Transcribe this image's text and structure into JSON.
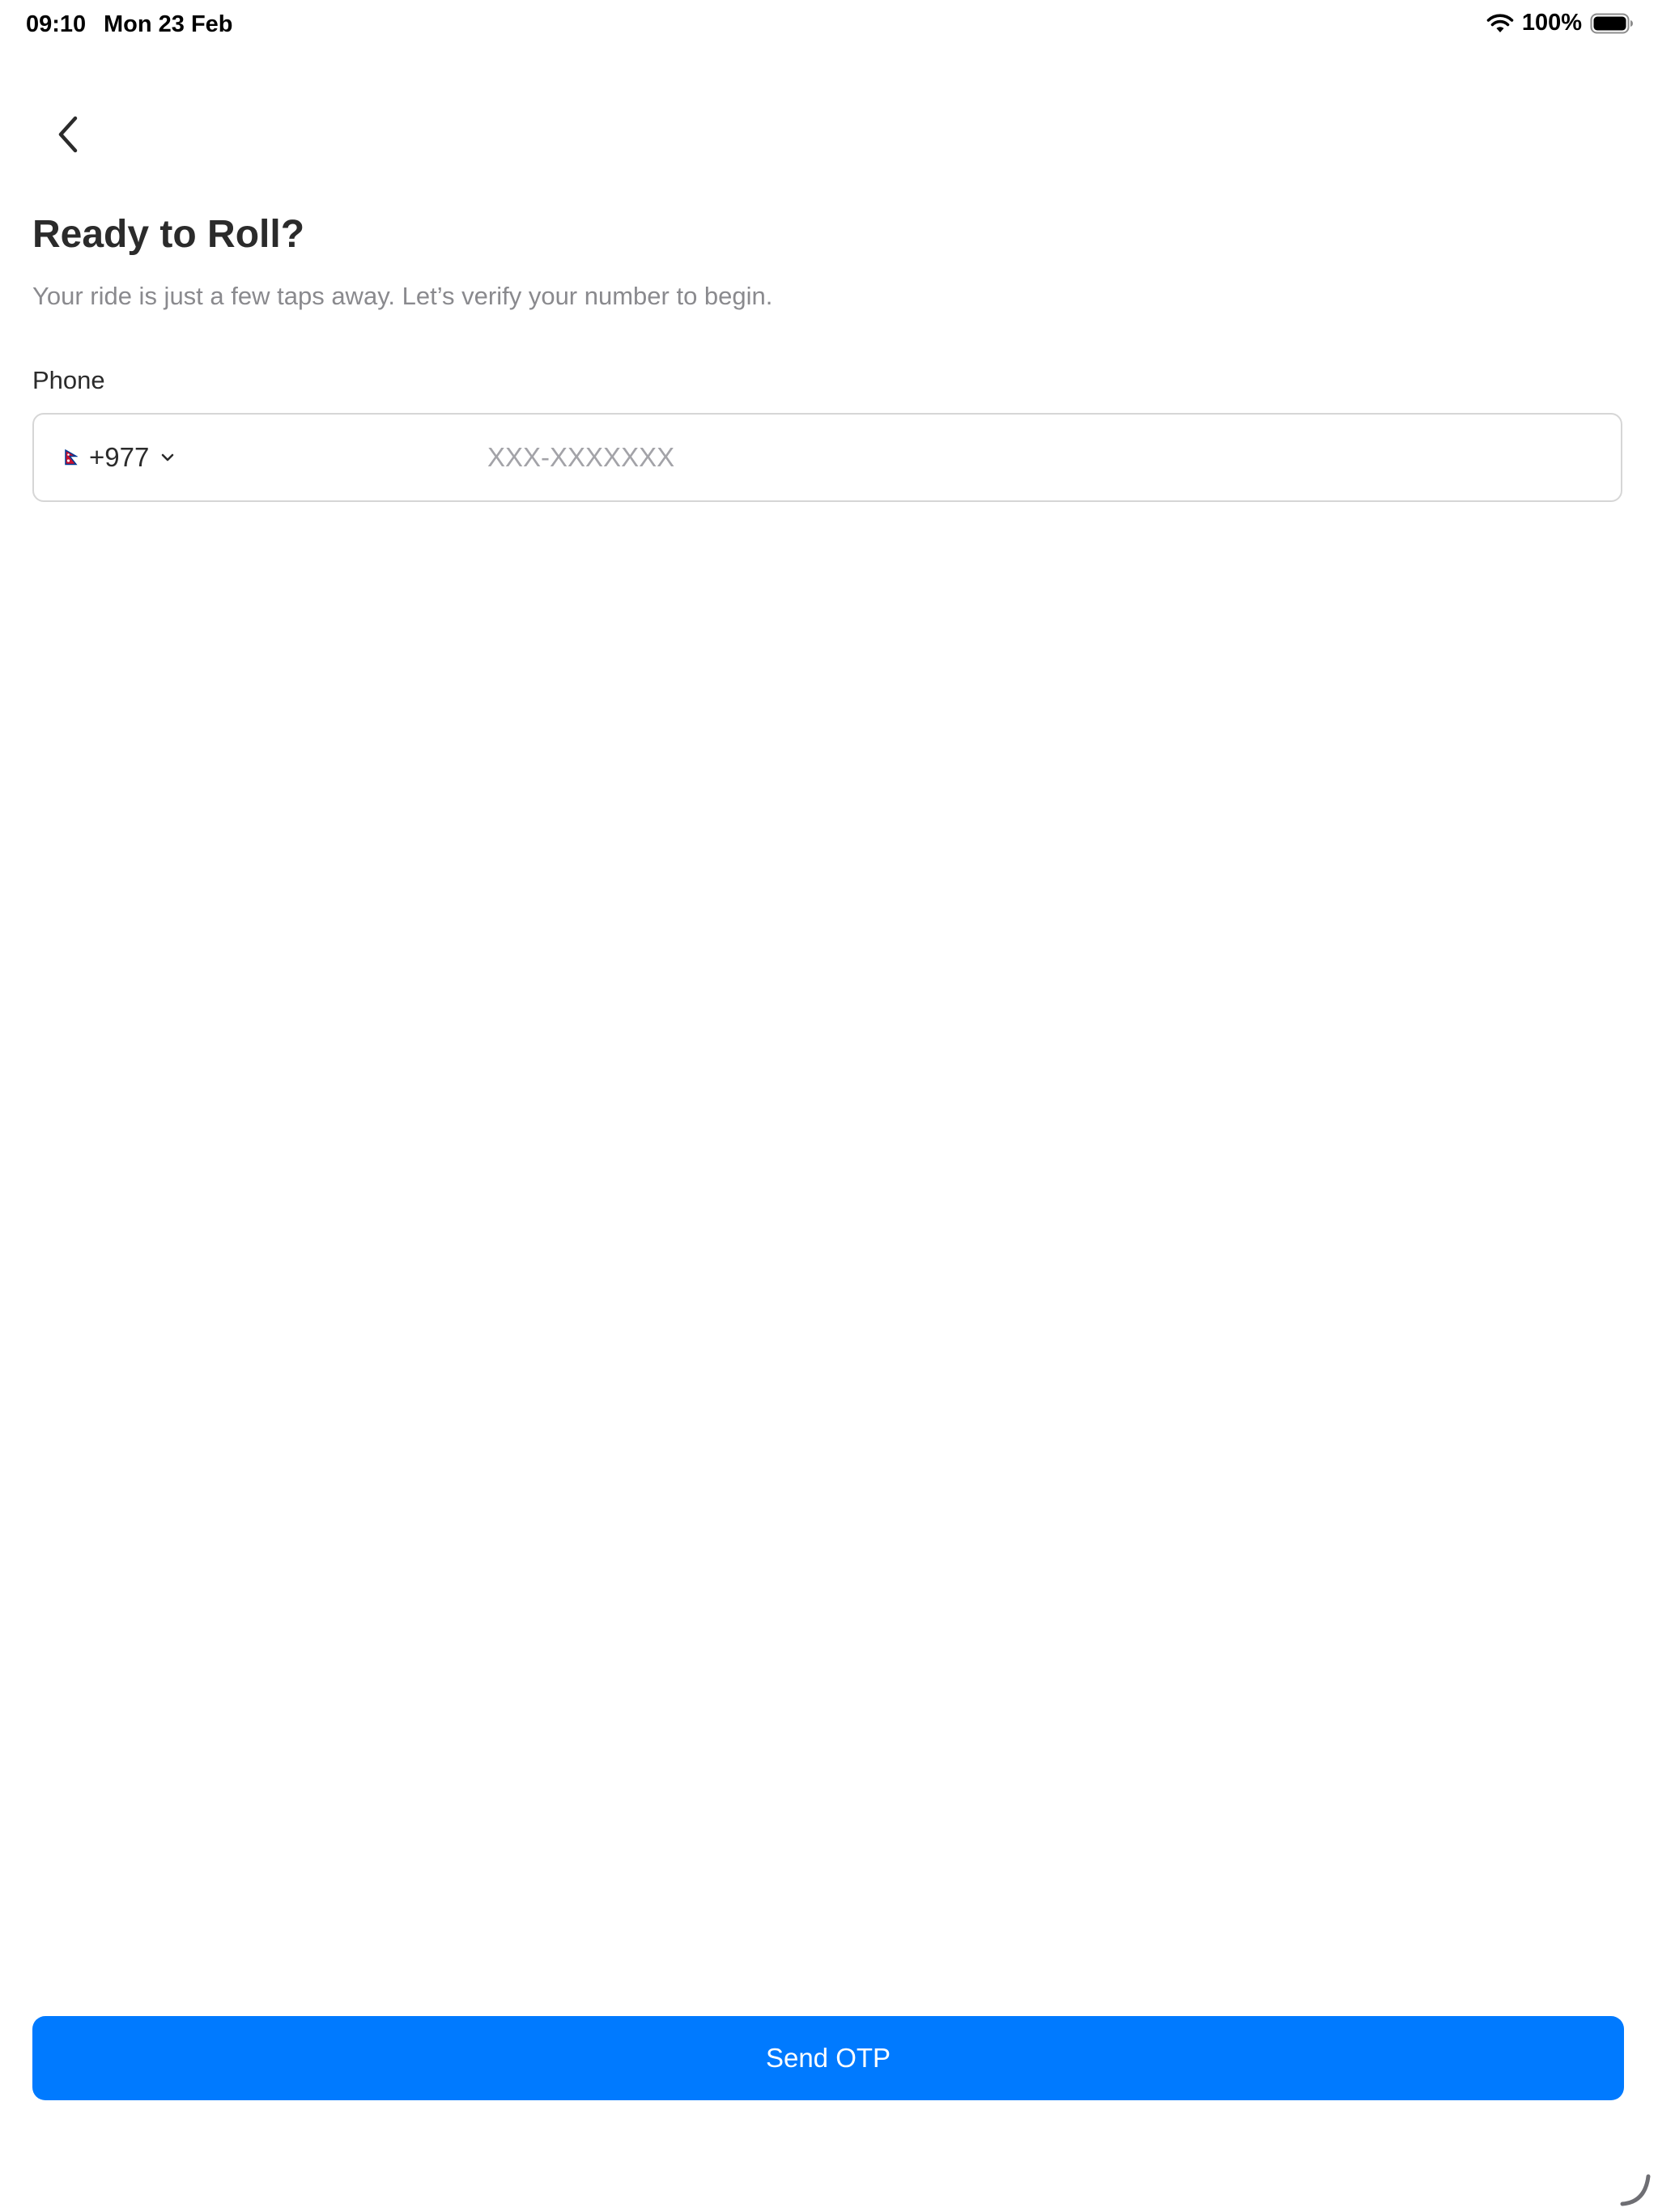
{
  "status_bar": {
    "time": "09:10",
    "date": "Mon 23 Feb",
    "battery_percent": "100%",
    "wifi_icon": "wifi-icon",
    "battery_icon": "battery-full-icon"
  },
  "nav": {
    "back_icon": "chevron-left-icon"
  },
  "header": {
    "title": "Ready to Roll?",
    "subtitle": "Your ride is just a few taps away. Let’s verify your number to begin."
  },
  "phone": {
    "label": "Phone",
    "country_flag_icon": "nepal-flag-icon",
    "country_code": "+977",
    "dropdown_icon": "chevron-down-icon",
    "placeholder": "XXX-XXXXXXX",
    "value": ""
  },
  "actions": {
    "send_otp_label": "Send OTP"
  },
  "colors": {
    "primary": "#007aff",
    "title_text": "#2b2b2b",
    "subtitle_text": "#8a8a8e",
    "placeholder_text": "#a3a3a8",
    "field_border": "#d6d6d6",
    "flag_red": "#c8102e",
    "flag_blue": "#003893"
  }
}
